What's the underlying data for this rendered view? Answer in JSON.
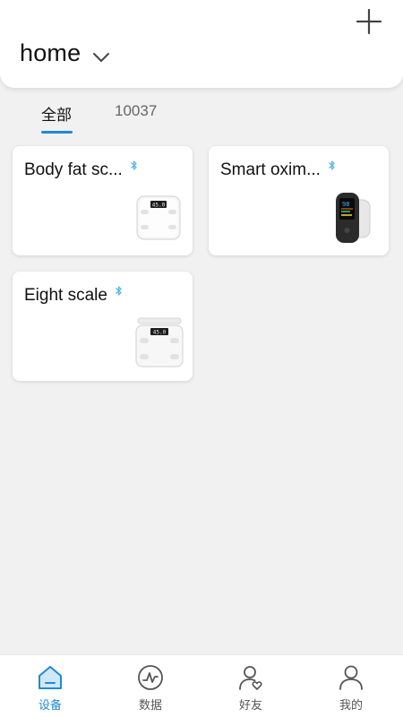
{
  "header": {
    "home_name": "home",
    "add_icon": "plus-icon",
    "dropdown_icon": "chevron-down-icon"
  },
  "tabs": [
    {
      "label": "全部",
      "active": true
    },
    {
      "label": "10037",
      "active": false
    }
  ],
  "devices": [
    {
      "name": "Body fat sc...",
      "connection_icon": "bluetooth-icon",
      "image": "body-fat-scale-image",
      "scale_display": "45.0"
    },
    {
      "name": "Smart oxim...",
      "connection_icon": "bluetooth-icon",
      "image": "pulse-oximeter-image",
      "oximeter_display": "98"
    },
    {
      "name": "Eight scale",
      "connection_icon": "bluetooth-icon",
      "image": "eight-electrode-scale-image",
      "scale_display": "45.0"
    }
  ],
  "bottom_nav": [
    {
      "label": "设备",
      "icon": "house-icon",
      "active": true
    },
    {
      "label": "数据",
      "icon": "activity-chart-icon",
      "active": false
    },
    {
      "label": "好友",
      "icon": "friend-heart-icon",
      "active": false
    },
    {
      "label": "我的",
      "icon": "person-icon",
      "active": false
    }
  ],
  "colors": {
    "accent": "#1e8ad6",
    "bluetooth": "#5fb8e8",
    "background": "#f1f1f1",
    "card": "#ffffff"
  }
}
